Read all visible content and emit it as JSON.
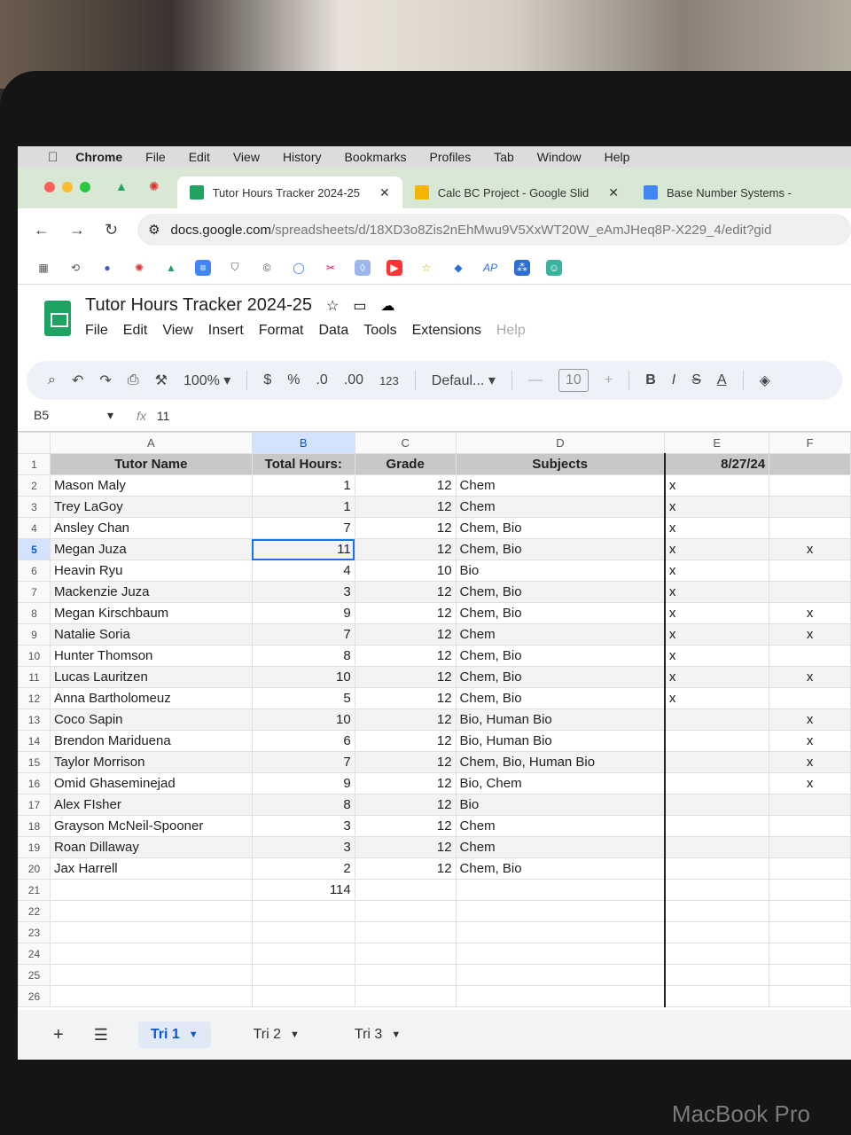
{
  "menubar": {
    "items": [
      "Chrome",
      "File",
      "Edit",
      "View",
      "History",
      "Bookmarks",
      "Profiles",
      "Tab",
      "Window",
      "Help"
    ]
  },
  "tabs": [
    {
      "title": "Tutor Hours Tracker 2024-25",
      "active": true,
      "icon": "sheets-icon",
      "color": "#1ea362"
    },
    {
      "title": "Calc BC Project - Google Slid",
      "active": false,
      "icon": "slides-icon",
      "color": "#f4b400"
    },
    {
      "title": "Base Number Systems -",
      "active": false,
      "icon": "docs-icon",
      "color": "#4285f4"
    }
  ],
  "address": {
    "host": "docs.google.com",
    "path": "/spreadsheets/d/18XD3o8Zis2nEhMwu9V5XxWT20W_eAmJHeq8P-X229_4/edit?gid"
  },
  "document": {
    "title": "Tutor Hours Tracker 2024-25",
    "menus": [
      "File",
      "Edit",
      "View",
      "Insert",
      "Format",
      "Data",
      "Tools",
      "Extensions",
      "Help"
    ]
  },
  "toolbar": {
    "zoom": "100%",
    "currency": "$",
    "percent": "%",
    "dec_decrease": ".0",
    "dec_increase": ".00",
    "number_format": "123",
    "font": "Defaul...",
    "font_size": "10",
    "minus": "—",
    "plus": "+",
    "bold": "B",
    "italic": "I",
    "strike": "S",
    "text_color": "A"
  },
  "formula_bar": {
    "cell_ref": "B5",
    "value": "11"
  },
  "columns": [
    "A",
    "B",
    "C",
    "D",
    "E",
    "F"
  ],
  "header": {
    "row": "1",
    "name": "Tutor Name",
    "hours": "Total Hours:",
    "grade": "Grade",
    "subjects": "Subjects",
    "date": "8/27/24",
    "f": ""
  },
  "rows": [
    {
      "n": "2",
      "name": "Mason Maly",
      "hours": "1",
      "grade": "12",
      "subjects": "Chem",
      "e": "x",
      "f": ""
    },
    {
      "n": "3",
      "name": "Trey LaGoy",
      "hours": "1",
      "grade": "12",
      "subjects": "Chem",
      "e": "x",
      "f": ""
    },
    {
      "n": "4",
      "name": "Ansley Chan",
      "hours": "7",
      "grade": "12",
      "subjects": "Chem, Bio",
      "e": "x",
      "f": ""
    },
    {
      "n": "5",
      "name": "Megan Juza",
      "hours": "11",
      "grade": "12",
      "subjects": "Chem, Bio",
      "e": "x",
      "f": "x"
    },
    {
      "n": "6",
      "name": "Heavin Ryu",
      "hours": "4",
      "grade": "10",
      "subjects": "Bio",
      "e": "x",
      "f": ""
    },
    {
      "n": "7",
      "name": "Mackenzie Juza",
      "hours": "3",
      "grade": "12",
      "subjects": "Chem, Bio",
      "e": "x",
      "f": ""
    },
    {
      "n": "8",
      "name": "Megan Kirschbaum",
      "hours": "9",
      "grade": "12",
      "subjects": "Chem, Bio",
      "e": "x",
      "f": "x"
    },
    {
      "n": "9",
      "name": "Natalie Soria",
      "hours": "7",
      "grade": "12",
      "subjects": "Chem",
      "e": "x",
      "f": "x"
    },
    {
      "n": "10",
      "name": "Hunter Thomson",
      "hours": "8",
      "grade": "12",
      "subjects": "Chem, Bio",
      "e": "x",
      "f": ""
    },
    {
      "n": "11",
      "name": "Lucas Lauritzen",
      "hours": "10",
      "grade": "12",
      "subjects": "Chem, Bio",
      "e": "x",
      "f": "x"
    },
    {
      "n": "12",
      "name": "Anna Bartholomeuz",
      "hours": "5",
      "grade": "12",
      "subjects": "Chem, Bio",
      "e": "x",
      "f": ""
    },
    {
      "n": "13",
      "name": "Coco Sapin",
      "hours": "10",
      "grade": "12",
      "subjects": "Bio, Human Bio",
      "e": "",
      "f": "x"
    },
    {
      "n": "14",
      "name": "Brendon Mariduena",
      "hours": "6",
      "grade": "12",
      "subjects": "Bio, Human Bio",
      "e": "",
      "f": "x"
    },
    {
      "n": "15",
      "name": "Taylor Morrison",
      "hours": "7",
      "grade": "12",
      "subjects": "Chem, Bio, Human Bio",
      "e": "",
      "f": "x"
    },
    {
      "n": "16",
      "name": "Omid Ghaseminejad",
      "hours": "9",
      "grade": "12",
      "subjects": "Bio, Chem",
      "e": "",
      "f": "x"
    },
    {
      "n": "17",
      "name": "Alex FIsher",
      "hours": "8",
      "grade": "12",
      "subjects": "Bio",
      "e": "",
      "f": ""
    },
    {
      "n": "18",
      "name": "Grayson McNeil-Spooner",
      "hours": "3",
      "grade": "12",
      "subjects": "Chem",
      "e": "",
      "f": ""
    },
    {
      "n": "19",
      "name": "Roan Dillaway",
      "hours": "3",
      "grade": "12",
      "subjects": "Chem",
      "e": "",
      "f": ""
    },
    {
      "n": "20",
      "name": "Jax Harrell",
      "hours": "2",
      "grade": "12",
      "subjects": "Chem, Bio",
      "e": "",
      "f": ""
    }
  ],
  "total": {
    "n": "21",
    "value": "114"
  },
  "empty_rows": [
    "22",
    "23",
    "24",
    "25",
    "26"
  ],
  "sheet_tabs": [
    {
      "label": "Tri 1",
      "active": true
    },
    {
      "label": "Tri 2",
      "active": false
    },
    {
      "label": "Tri 3",
      "active": false
    }
  ],
  "brand": "MacBook Pro"
}
